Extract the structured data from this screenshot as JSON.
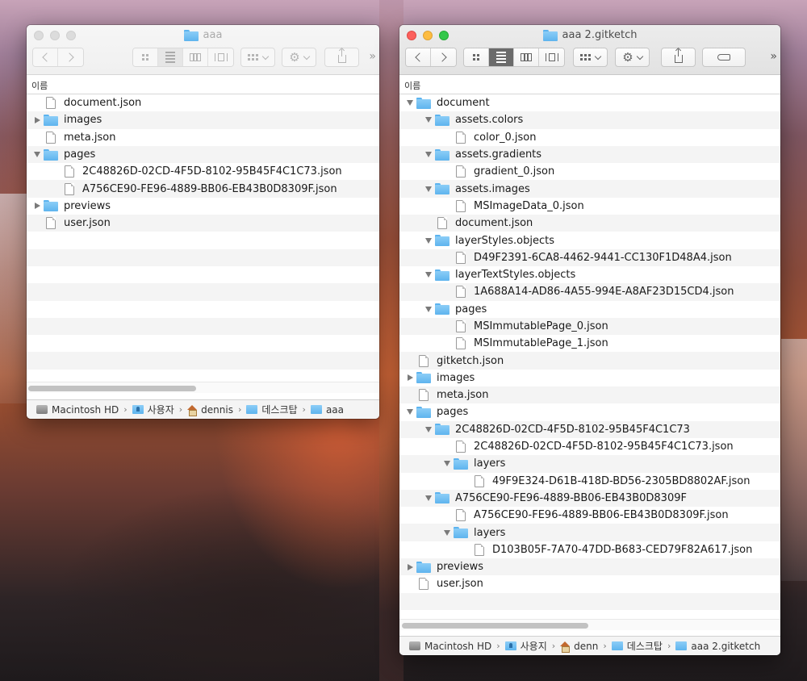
{
  "window_left": {
    "title": "aaa",
    "column_header": "이름",
    "rows": [
      {
        "depth": 0,
        "kind": "file",
        "expander": "none",
        "label": "document.json"
      },
      {
        "depth": 0,
        "kind": "folder",
        "expander": "closed",
        "label": "images"
      },
      {
        "depth": 0,
        "kind": "file",
        "expander": "none",
        "label": "meta.json"
      },
      {
        "depth": 0,
        "kind": "folder",
        "expander": "open",
        "label": "pages"
      },
      {
        "depth": 1,
        "kind": "file",
        "expander": "none",
        "label": "2C48826D-02CD-4F5D-8102-95B45F4C1C73.json"
      },
      {
        "depth": 1,
        "kind": "file",
        "expander": "none",
        "label": "A756CE90-FE96-4889-BB06-EB43B0D8309F.json"
      },
      {
        "depth": 0,
        "kind": "folder",
        "expander": "closed",
        "label": "previews"
      },
      {
        "depth": 0,
        "kind": "file",
        "expander": "none",
        "label": "user.json"
      }
    ],
    "empty_rows": 9,
    "path": [
      {
        "icon": "hd",
        "label": "Macintosh HD"
      },
      {
        "icon": "user-folder",
        "label": "사용자"
      },
      {
        "icon": "home",
        "label": "dennis"
      },
      {
        "icon": "folder",
        "label": "데스크탑"
      },
      {
        "icon": "folder",
        "label": "aaa"
      }
    ]
  },
  "window_right": {
    "title": "aaa 2.gitketch",
    "column_header": "이름",
    "rows": [
      {
        "depth": 0,
        "kind": "folder",
        "expander": "open",
        "label": "document"
      },
      {
        "depth": 1,
        "kind": "folder",
        "expander": "open",
        "label": "assets.colors"
      },
      {
        "depth": 2,
        "kind": "file",
        "expander": "none",
        "label": "color_0.json"
      },
      {
        "depth": 1,
        "kind": "folder",
        "expander": "open",
        "label": "assets.gradients"
      },
      {
        "depth": 2,
        "kind": "file",
        "expander": "none",
        "label": "gradient_0.json"
      },
      {
        "depth": 1,
        "kind": "folder",
        "expander": "open",
        "label": "assets.images"
      },
      {
        "depth": 2,
        "kind": "file",
        "expander": "none",
        "label": "MSImageData_0.json"
      },
      {
        "depth": 1,
        "kind": "file",
        "expander": "none",
        "label": "document.json"
      },
      {
        "depth": 1,
        "kind": "folder",
        "expander": "open",
        "label": "layerStyles.objects"
      },
      {
        "depth": 2,
        "kind": "file",
        "expander": "none",
        "label": "D49F2391-6CA8-4462-9441-CC130F1D48A4.json"
      },
      {
        "depth": 1,
        "kind": "folder",
        "expander": "open",
        "label": "layerTextStyles.objects"
      },
      {
        "depth": 2,
        "kind": "file",
        "expander": "none",
        "label": "1A688A14-AD86-4A55-994E-A8AF23D15CD4.json"
      },
      {
        "depth": 1,
        "kind": "folder",
        "expander": "open",
        "label": "pages"
      },
      {
        "depth": 2,
        "kind": "file",
        "expander": "none",
        "label": "MSImmutablePage_0.json"
      },
      {
        "depth": 2,
        "kind": "file",
        "expander": "none",
        "label": "MSImmutablePage_1.json"
      },
      {
        "depth": 0,
        "kind": "file",
        "expander": "none",
        "label": "gitketch.json"
      },
      {
        "depth": 0,
        "kind": "folder",
        "expander": "closed",
        "label": "images"
      },
      {
        "depth": 0,
        "kind": "file",
        "expander": "none",
        "label": "meta.json"
      },
      {
        "depth": 0,
        "kind": "folder",
        "expander": "open",
        "label": "pages"
      },
      {
        "depth": 1,
        "kind": "folder",
        "expander": "open",
        "label": "2C48826D-02CD-4F5D-8102-95B45F4C1C73"
      },
      {
        "depth": 2,
        "kind": "file",
        "expander": "none",
        "label": "2C48826D-02CD-4F5D-8102-95B45F4C1C73.json"
      },
      {
        "depth": 2,
        "kind": "folder",
        "expander": "open",
        "label": "layers"
      },
      {
        "depth": 3,
        "kind": "file",
        "expander": "none",
        "label": "49F9E324-D61B-418D-BD56-2305BD8802AF.json"
      },
      {
        "depth": 1,
        "kind": "folder",
        "expander": "open",
        "label": "A756CE90-FE96-4889-BB06-EB43B0D8309F"
      },
      {
        "depth": 2,
        "kind": "file",
        "expander": "none",
        "label": "A756CE90-FE96-4889-BB06-EB43B0D8309F.json"
      },
      {
        "depth": 2,
        "kind": "folder",
        "expander": "open",
        "label": "layers"
      },
      {
        "depth": 3,
        "kind": "file",
        "expander": "none",
        "label": "D103B05F-7A70-47DD-B683-CED79F82A617.json"
      },
      {
        "depth": 0,
        "kind": "folder",
        "expander": "closed",
        "label": "previews"
      },
      {
        "depth": 0,
        "kind": "file",
        "expander": "none",
        "label": "user.json"
      }
    ],
    "empty_rows": 1,
    "path": [
      {
        "icon": "hd",
        "label": "Macintosh HD"
      },
      {
        "icon": "user-folder",
        "label": "사용지"
      },
      {
        "icon": "home",
        "label": "denn"
      },
      {
        "icon": "folder",
        "label": "데스크탑"
      },
      {
        "icon": "folder",
        "label": "aaa 2.gitketch"
      }
    ]
  },
  "toolbar": {
    "back_icon": "chevron-left-icon",
    "forward_icon": "chevron-right-icon",
    "view_modes": [
      "icon-view-icon",
      "list-view-icon",
      "column-view-icon",
      "cover-flow-icon"
    ],
    "selected_view": "list-view-icon",
    "arrange_icon": "arrange-icon",
    "action_icon": "gear-icon",
    "share_icon": "share-icon",
    "tag_icon": "tag-icon",
    "overflow_label": "»"
  },
  "colors": {
    "close": "#fc605c",
    "minimize": "#fdbc40",
    "zoom": "#34c84a",
    "folder": "#5eb4ee",
    "stripe": "#f4f4f4"
  }
}
